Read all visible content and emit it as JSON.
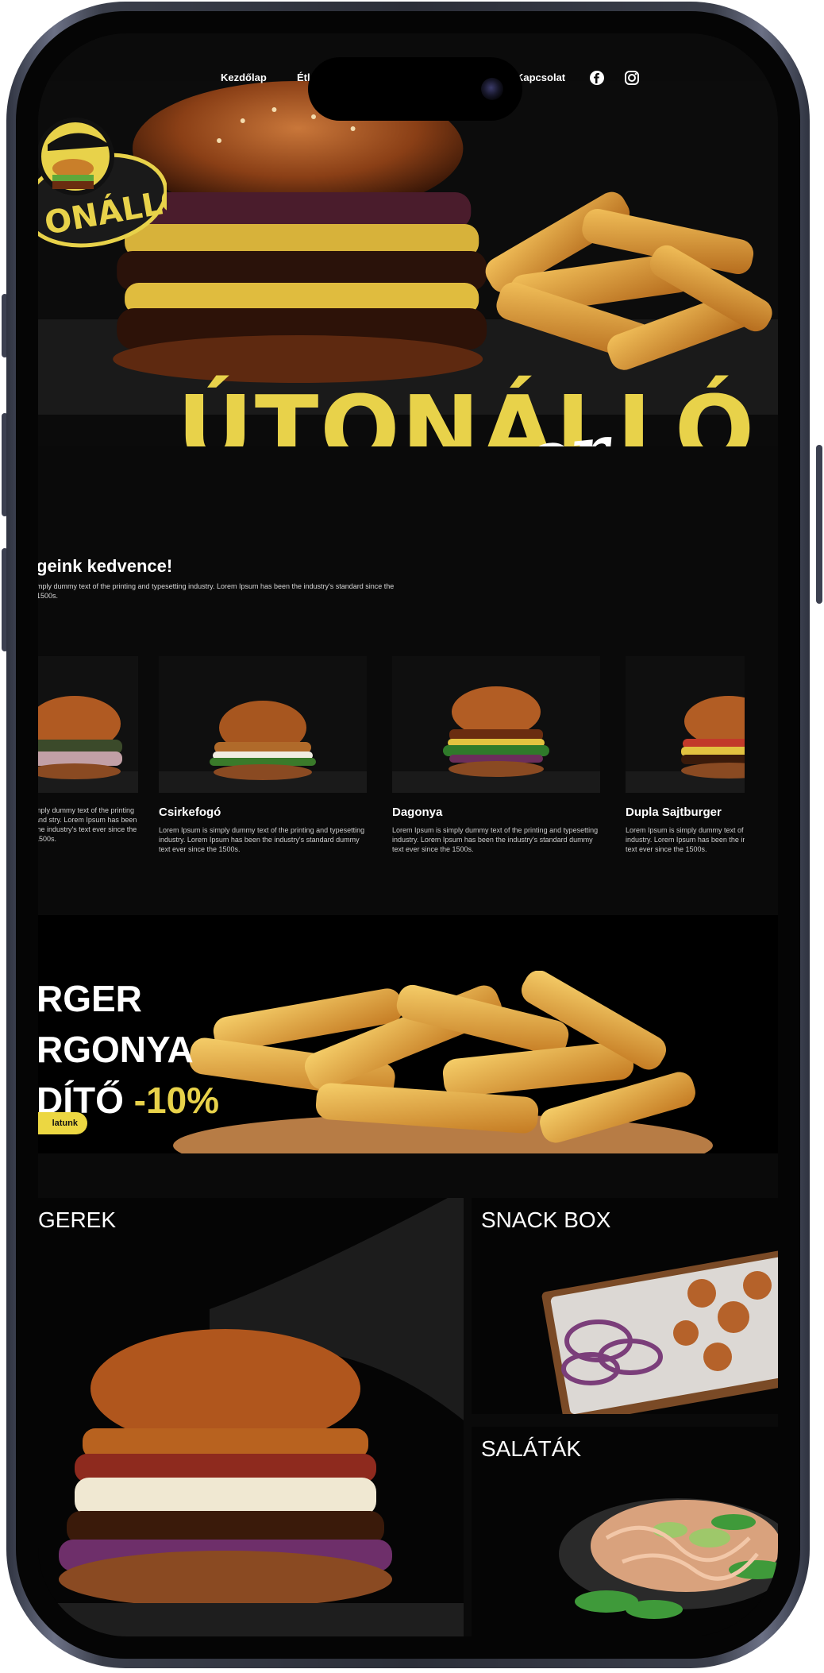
{
  "nav": {
    "items": [
      {
        "label": "Kezdőlap"
      },
      {
        "label": "Étla"
      },
      {
        "label": "Kapcsolat"
      }
    ],
    "icons": [
      "facebook-icon",
      "instagram-icon"
    ]
  },
  "hero": {
    "title": "ÚTONÁLLÓ",
    "subtitle": "Burger",
    "logo_text": "ONÁLLÓ"
  },
  "favorites": {
    "title": "geink kedvence!",
    "description": "mply dummy text of the printing and typesetting industry. Lorem Ipsum has been the industry's standard since the 1500s.",
    "cards": [
      {
        "name": "",
        "text": "mply dummy text of the printing and stry. Lorem Ipsum has been the industry's text ever since the 1500s."
      },
      {
        "name": "Csirkefogó",
        "text": "Lorem Ipsum is simply dummy text of the printing and typesetting industry. Lorem Ipsum has been the industry's standard dummy text ever since the 1500s."
      },
      {
        "name": "Dagonya",
        "text": "Lorem Ipsum is simply dummy text of the printing and typesetting industry. Lorem Ipsum has been the industry's standard dummy text ever since the 1500s."
      },
      {
        "name": "Dupla Sajtburger",
        "text": "Lorem Ipsum is simply dummy text of the printing and typesetting industry. Lorem Ipsum has been the industry's standard dummy text ever since the 1500s."
      }
    ]
  },
  "promo": {
    "line1": "RGER",
    "line2": "RGONYA",
    "line3_prefix": "DÍTŐ",
    "line3_accent": "-10%",
    "button_label": "latunk"
  },
  "categories": [
    {
      "title": "GEREK"
    },
    {
      "title": "SNACK BOX"
    },
    {
      "title": "SALÁTÁK"
    }
  ],
  "colors": {
    "accent": "#e8d24a",
    "background": "#0a0a0a",
    "text": "#ffffff"
  }
}
